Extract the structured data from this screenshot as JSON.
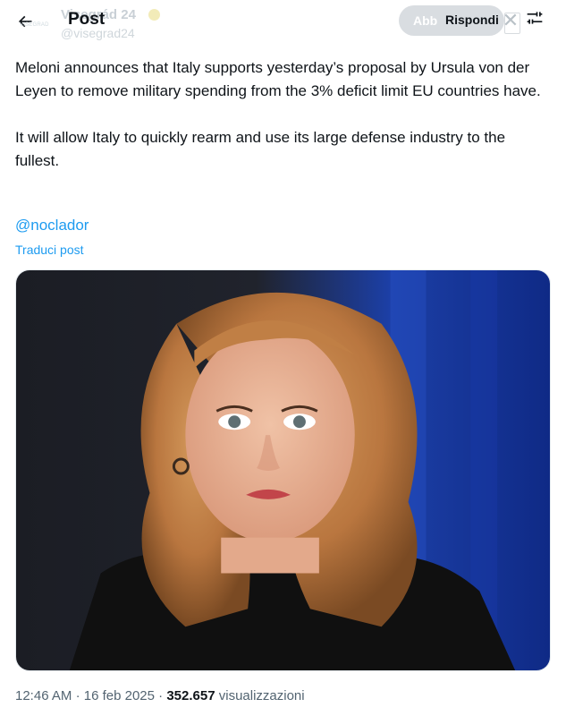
{
  "header": {
    "title": "Post",
    "back_icon": "arrow-left-icon",
    "ghost_name": "Visegrád 24",
    "ghost_handle": "@visegrad24",
    "ghost_follow": "Abb",
    "reply_label": "Rispondi",
    "close_icon": "x-close-icon",
    "settings_icon": "sliders-icon"
  },
  "tweet": {
    "paragraph1": "Meloni announces that Italy supports yesterday’s proposal by Ursula von der Leyen to remove military spending from the 3% deficit limit EU countries have.",
    "paragraph2": "It will allow Italy to quickly rearm and use its large defense industry to the fullest.",
    "mention": "@noclador",
    "translate_label": "Traduci post"
  },
  "meta": {
    "time": "12:46 AM",
    "date": "16 feb 2025",
    "separator": "·",
    "views_count": "352.657",
    "views_label": "visualizzazioni"
  },
  "colors": {
    "accent": "#1d9bf0",
    "text": "#0f1419",
    "secondary": "#536471"
  }
}
